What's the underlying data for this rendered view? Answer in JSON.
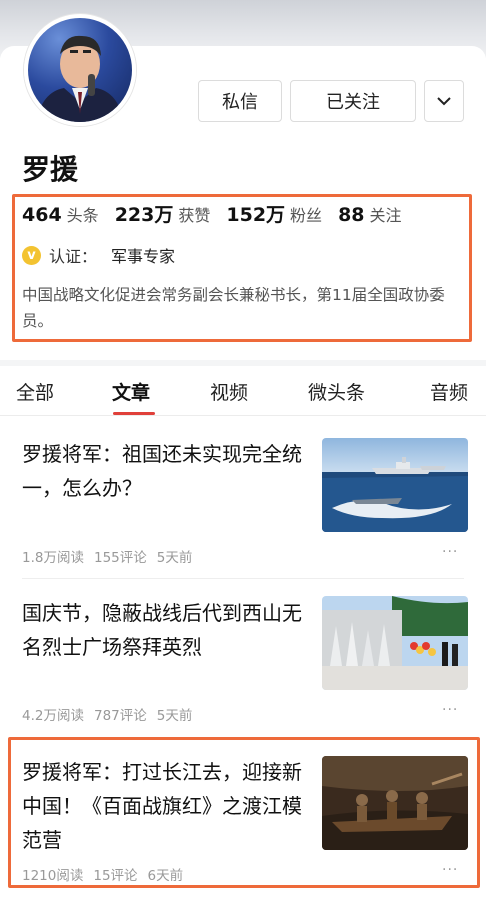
{
  "profile": {
    "name": "罗援",
    "buttons": {
      "message": "私信",
      "follow": "已关注",
      "more_icon": "chevron-down-icon"
    },
    "stats": [
      {
        "num": "464",
        "label": "头条"
      },
      {
        "num": "223万",
        "label": "获赞"
      },
      {
        "num": "152万",
        "label": "粉丝"
      },
      {
        "num": "88",
        "label": "关注"
      }
    ],
    "verify": {
      "icon": "v",
      "label": "认证：",
      "value": "军事专家"
    },
    "bio": "中国战略文化促进会常务副会长兼秘书长，第11届全国政协委员。"
  },
  "tabs": [
    "全部",
    "文章",
    "视频",
    "微头条",
    "音频"
  ],
  "active_tab": "文章",
  "articles": [
    {
      "title": "罗援将军：祖国还未实现完全统一，怎么办？",
      "reads": "1.8万阅读",
      "comments": "155评论",
      "time": "5天前",
      "more": "···"
    },
    {
      "title": "国庆节，隐蔽战线后代到西山无名烈士广场祭拜英烈",
      "reads": "4.2万阅读",
      "comments": "787评论",
      "time": "5天前",
      "more": "···"
    },
    {
      "title": "罗援将军：打过长江去，迎接新中国！《百面战旗红》之渡江模范营",
      "reads": "1210阅读",
      "comments": "15评论",
      "time": "6天前",
      "more": "···"
    }
  ],
  "colors": {
    "highlight": "#ee6a3a",
    "tab_underline": "#e0403a",
    "verify_badge": "#f3c331"
  }
}
